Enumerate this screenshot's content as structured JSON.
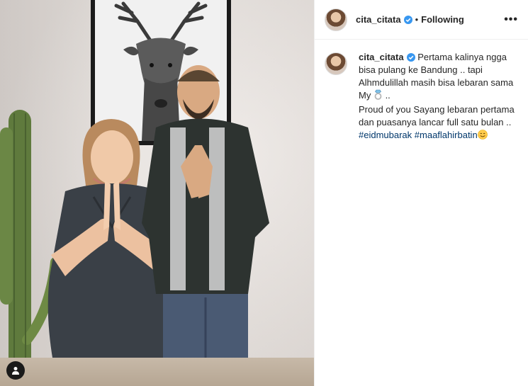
{
  "post": {
    "username": "cita_citata",
    "separator": "•",
    "follow_status": "Following",
    "more_label": "•••"
  },
  "caption": {
    "line1": "Pertama kalinya ngga bisa pulang ke Bandung .. tapi Alhmdulillah masih bisa lebaran sama My ",
    "line1_after": " ..",
    "line2": "Proud of you Sayang lebaran pertama dan puasanya lancar full satu bulan ..",
    "hashtag1": "#eidmubarak",
    "hashtag2": "#maaflahirbatin"
  },
  "icons": {
    "verified": "verified-badge-icon",
    "ring": "ring-emoji-icon",
    "smile": "smiling-face-emoji-icon",
    "user_tag": "user-tag-icon"
  },
  "colors": {
    "verified_blue": "#3897f0",
    "hashtag_blue": "#00376b",
    "text": "#262626"
  }
}
